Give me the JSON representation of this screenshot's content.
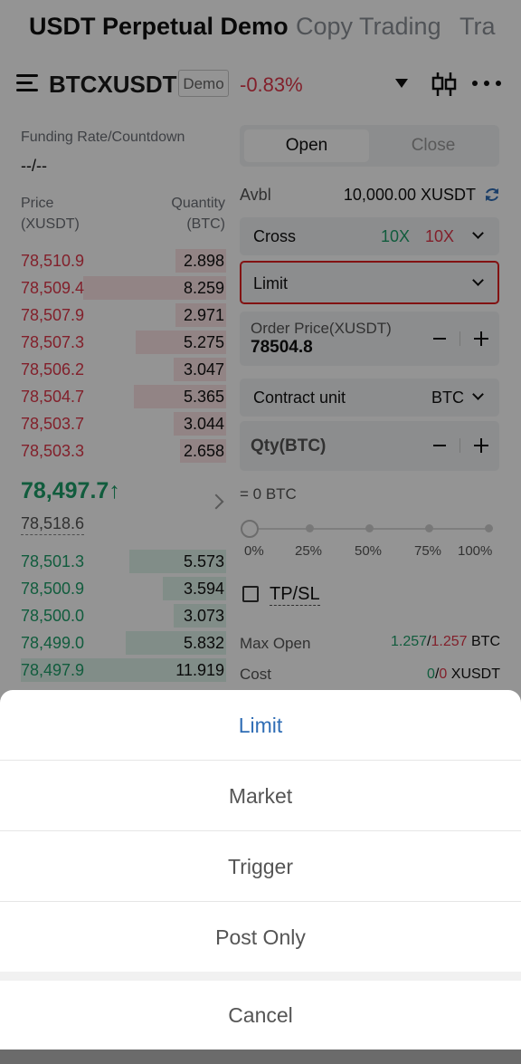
{
  "tabs": [
    {
      "label": "USDT Perpetual Demo",
      "active": true
    },
    {
      "label": "Copy Trading",
      "active": false
    },
    {
      "label": "Tra",
      "active": false
    }
  ],
  "header": {
    "symbol": "BTCXUSDT",
    "badge": "Demo",
    "change": "-0.83%",
    "icons": [
      "menu-icon",
      "dropdown-icon",
      "candlestick-icon",
      "more-icon"
    ]
  },
  "funding": {
    "label": "Funding Rate/Countdown",
    "value": "--/--"
  },
  "orderbook": {
    "price_header": [
      "Price",
      "(XUSDT)"
    ],
    "qty_header": [
      "Quantity",
      "(BTC)"
    ],
    "asks": [
      {
        "price": "78,510.9",
        "qty": "2.898",
        "depth": 0.24
      },
      {
        "price": "78,509.4",
        "qty": "8.259",
        "depth": 0.68
      },
      {
        "price": "78,507.9",
        "qty": "2.971",
        "depth": 0.24
      },
      {
        "price": "78,507.3",
        "qty": "5.275",
        "depth": 0.43
      },
      {
        "price": "78,506.2",
        "qty": "3.047",
        "depth": 0.25
      },
      {
        "price": "78,504.7",
        "qty": "5.365",
        "depth": 0.44
      },
      {
        "price": "78,503.7",
        "qty": "3.044",
        "depth": 0.25
      },
      {
        "price": "78,503.3",
        "qty": "2.658",
        "depth": 0.22
      }
    ],
    "last_price": "78,497.7↑",
    "mark_price": "78,518.6",
    "bids": [
      {
        "price": "78,501.3",
        "qty": "5.573",
        "depth": 0.46
      },
      {
        "price": "78,500.9",
        "qty": "3.594",
        "depth": 0.3
      },
      {
        "price": "78,500.0",
        "qty": "3.073",
        "depth": 0.25
      },
      {
        "price": "78,499.0",
        "qty": "5.832",
        "depth": 0.48
      },
      {
        "price": "78,497.9",
        "qty": "11.919",
        "depth": 0.98
      }
    ]
  },
  "order_form": {
    "open_label": "Open",
    "close_label": "Close",
    "avbl_label": "Avbl",
    "avbl_value": "10,000.00 XUSDT",
    "margin_mode": "Cross",
    "leverage_long": "10X",
    "leverage_short": "10X",
    "order_type": "Limit",
    "price_label": "Order Price(XUSDT)",
    "price_value": "78504.8",
    "unit_label": "Contract unit",
    "unit_value": "BTC",
    "qty_placeholder": "Qty(BTC)",
    "qty_equiv": "= 0 BTC",
    "slider_percent": 0,
    "slider_marks": [
      "0%",
      "25%",
      "50%",
      "75%",
      "100%"
    ],
    "tpsl_label": "TP/SL",
    "tpsl_checked": false,
    "max_open_label": "Max Open",
    "max_open_long": "1.257",
    "max_open_short": "1.257",
    "max_open_unit": "BTC",
    "cost_label": "Cost",
    "cost_long": "0",
    "cost_short": "0",
    "cost_unit": "XUSDT"
  },
  "sheet": {
    "options": [
      {
        "label": "Limit",
        "selected": true
      },
      {
        "label": "Market",
        "selected": false
      },
      {
        "label": "Trigger",
        "selected": false
      },
      {
        "label": "Post Only",
        "selected": false
      }
    ],
    "cancel_label": "Cancel"
  },
  "colors": {
    "up": "#1e9f6a",
    "down": "#e0384a",
    "selected": "#2f6db5",
    "highlight_border": "#e02020"
  }
}
